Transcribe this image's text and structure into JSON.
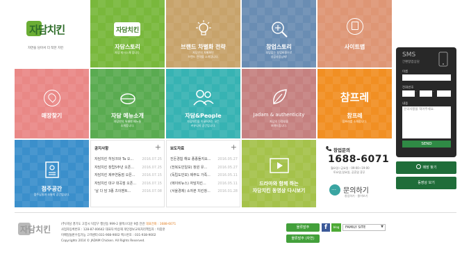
{
  "logo": {
    "text": "자담치킨",
    "tagline": "자연을 담아서 더 착한 치킨"
  },
  "tiles": {
    "story": {
      "logo": "자담치킨",
      "title": "자담스토리",
      "sub": "자담 회사소개 입니다."
    },
    "brand": {
      "title": "브랜드 차별화 전략",
      "sub": "자담만의 차별화된\n브랜드 전략을 소개합니다."
    },
    "startup": {
      "title": "창업스토리",
      "sub": "부담없는 창업비용으로\n성공사업님께!"
    },
    "sitemap": {
      "title": "사이트맵"
    },
    "store": {
      "title": "매장찾기"
    },
    "menu": {
      "title": "자담 메뉴소개",
      "sub": "자담만의 특별한 메뉴들\n소개합니다."
    },
    "people": {
      "title": "자담&People",
      "sub": "자담치킨을 이끌어가는 모든\n커뮤니티 공간입니다."
    },
    "authentic": {
      "title": "Jadam & authenticity",
      "sub": "자담의 진정성을\n보여드립니다."
    },
    "champre": {
      "logo": "참프레",
      "title": "참프레",
      "sub": "참프레를 소개합니다."
    },
    "community": {
      "title": "점주공간",
      "sub": "점주님들과 소통의 공간입니다."
    },
    "video": {
      "title": "드라마와 함께 하는\n자담치킨 동영상 다시보기"
    }
  },
  "notice": {
    "title": "공지사항",
    "plus": "+",
    "items": [
      {
        "title": "자담치킨 히딩크와 Ta 오...",
        "date": "2016.07.25"
      },
      {
        "title": "자담치킨 창립5주년 오픈...",
        "date": "2016.07.25"
      },
      {
        "title": "자담치킨 제주연동점 오픈...",
        "date": "2016.07.15"
      },
      {
        "title": "자담치킨 대구 대곡점 오픈...",
        "date": "2016.07.15"
      },
      {
        "title": "'날 다 담 3종 츠이벤트...",
        "date": "2016.07.08"
      }
    ]
  },
  "press": {
    "title": "보도자료",
    "plus": "+",
    "items": [
      {
        "title": "진돈경험 해요 종종돌지요...",
        "date": "2016.05.27"
      },
      {
        "title": "(전복도민일보) 창원 유...",
        "date": "2016.05.27"
      },
      {
        "title": "(독립도민보) 제주도 가족...",
        "date": "2016.05.11"
      },
      {
        "title": "(에이비뉴스) 자담치킨...",
        "date": "2016.05.11"
      },
      {
        "title": "(서울경제) 소자본 치킨창...",
        "date": "2016.01.28"
      }
    ]
  },
  "startup_inquiry": {
    "label": "창업문의",
    "phone": "1688-6071",
    "hours1": "월요일~금요일 : 09:00~19:00",
    "hours2": "토요일,일요일, 공휴일 휴무",
    "ask_title": "문의하기",
    "ask_sub": "창업하기 · 물어보기"
  },
  "sms": {
    "title": "SMS",
    "subtitle": "간편창업상담",
    "name_label": "이름",
    "phone_label": "전화번호",
    "content_label": "내용",
    "content_placeholder": "문의사항을 적어주세요.",
    "send": "SEND"
  },
  "side_buttons": {
    "store_find": "매장 찾기",
    "video": "동영상 보기"
  },
  "footer": {
    "line1": "(주)자담 경기도 고양시 덕양구 행신동 999-2 블랙스타운 9층 전관",
    "line1_tail": "대표전화 : 1688-6071",
    "line2": "사업자등록번호 : 128-87-00642 대표자:박상재 개인정보교육처리책임자 : 이중훈",
    "line3": "이메일들판수입가능 고객센터:031-908-9002 팩스번호 : 031-938-9002",
    "line4": "Copyrights 2014 © JADAM Chicken. All Rights Reserved.",
    "btn_order": "물류발주",
    "btn_order2": "물류발주 (자연)",
    "family_site": "FAMILY SITE",
    "blog_label": "blog",
    "fb_label": "f"
  },
  "colors": {
    "green": "#79b83c",
    "tan": "#c7a36b",
    "blue": "#6a8db3",
    "salmon": "#de9675",
    "pink": "#e98886",
    "green2": "#5aab51",
    "teal": "#37b3b3",
    "mauve": "#c58180",
    "orange": "#f18f23",
    "blue2": "#3b8fcb",
    "olive": "#a5c24b"
  }
}
